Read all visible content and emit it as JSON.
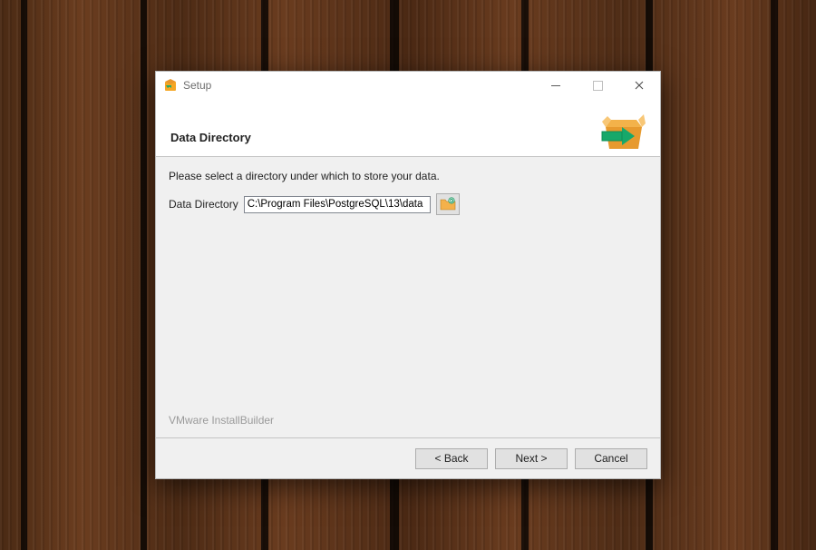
{
  "titlebar": {
    "title": "Setup"
  },
  "header": {
    "heading": "Data Directory"
  },
  "content": {
    "instruction": "Please select a directory under which to store your data.",
    "field_label": "Data Directory",
    "field_value": "C:\\Program Files\\PostgreSQL\\13\\data"
  },
  "branding": {
    "install_builder": "VMware InstallBuilder"
  },
  "footer": {
    "back": "< Back",
    "next": "Next >",
    "cancel": "Cancel"
  }
}
